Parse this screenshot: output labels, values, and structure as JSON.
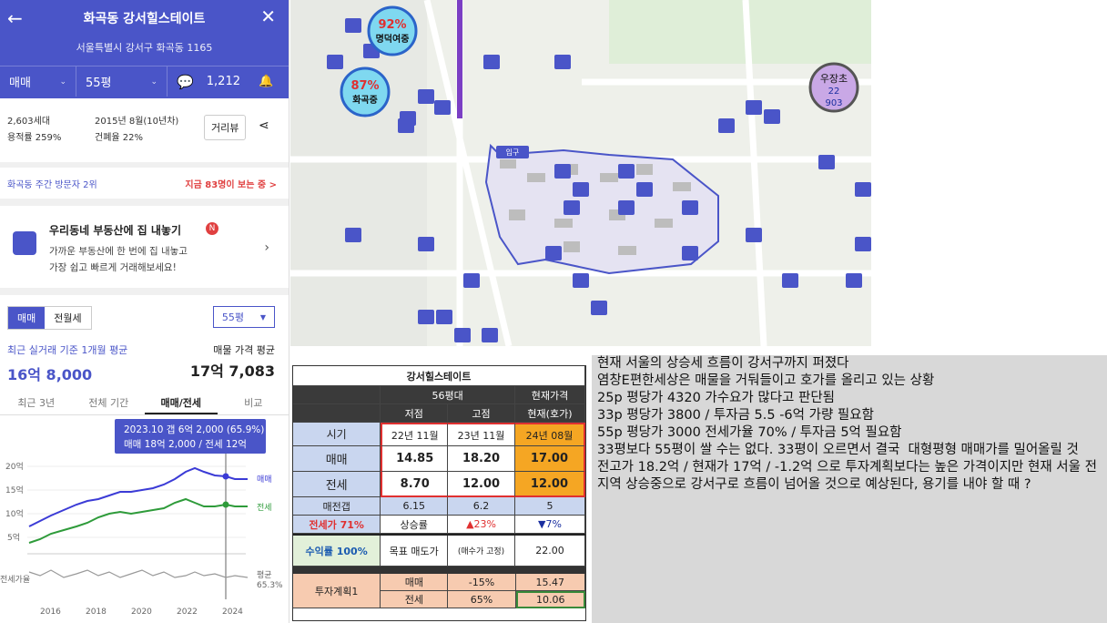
{
  "header": {
    "title": "화곡동 강서힐스테이트",
    "address": "서울특별시 강서구 화곡동 1165",
    "trade": "매매",
    "size": "55평",
    "comments": "1,212"
  },
  "complex": {
    "households": "2,603세대",
    "built": "2015년 8월(10년차)",
    "floor_area_ratio": "용적률 259%",
    "coverage": "건폐율 22%",
    "review_btn": "거리뷰"
  },
  "visitor": {
    "rank": "화곡동 주간 방문자 2위",
    "now": "지금 83명이 보는 중 >"
  },
  "promo": {
    "title": "우리동네 부동산에 집 내놓기",
    "badge": "N",
    "line1": "가까운 부동산에 한 번에 집 내놓고",
    "line2": "가장 쉽고 빠르게 거래해보세요!"
  },
  "price": {
    "tab1": "매매",
    "tab2": "전월세",
    "size": "55평",
    "recent_label": "최근 실거래 기준 1개월 평균",
    "recent_value": "16억 8,000",
    "ask_label": "매물 가격 평균",
    "ask_value": "17억 7,083"
  },
  "period_tabs": [
    "최근 3년",
    "전체 기간",
    "매매/전세",
    "비교"
  ],
  "chart": {
    "tooltip1": "2023.10  갭 6억 2,000 (65.9%)",
    "tooltip2": "매매 18억 2,000 / 전세 12억",
    "yticks": [
      "20억",
      "15억",
      "10억",
      "5억"
    ],
    "sale_label": "매매",
    "jeonse_label": "전세",
    "ratio_label": "전세가율",
    "avg_label": "평균",
    "avg_value": "65.3%",
    "xticks": [
      "2016",
      "2018",
      "2020",
      "2022",
      "2024"
    ]
  },
  "map_labels": {
    "school1": "92%",
    "school1_name": "명덕여중",
    "school2": "87%",
    "school2_name": "화곡중",
    "school3_name": "우장초",
    "school3_a": "22",
    "school3_b": "903",
    "entrance": "입구"
  },
  "table": {
    "title": "강서힐스테이트",
    "h_group": "56평대",
    "h_now": "현재가격",
    "h_low": "저점",
    "h_fix": "고점",
    "h_now2": "현재(호가)",
    "rows": [
      {
        "label": "시기",
        "a": "22년 11월",
        "b": "23년 11월",
        "c": "24년 08월"
      },
      {
        "label": "매매",
        "a": "14.85",
        "b": "18.20",
        "c": "17.00"
      },
      {
        "label": "전세",
        "a": "8.70",
        "b": "12.00",
        "c": "12.00"
      }
    ],
    "gap_label": "매전갭",
    "gap": [
      "6.15",
      "6.2",
      "5"
    ],
    "ratio_label": "전세가 71%",
    "rise_label": "상승률",
    "rise": "▲23%",
    "fall": "▼7%",
    "yield_label": "수익률 100%",
    "target_label": "목표 매도가",
    "target_note": "(매수가 고정)",
    "target": "22.00",
    "plan_label": "투자계획1",
    "plan_rows": [
      {
        "k": "매매",
        "p": "-15%",
        "v": "15.47"
      },
      {
        "k": "전세",
        "p": "65%",
        "v": "10.06"
      }
    ]
  },
  "note": [
    "현재 서울의 상승세 흐름이 강서구까지 퍼졌다",
    "염창E편한세상은 매물을 거둬들이고 호가를 올리고 있는 상황",
    "",
    "25p 평당가 4320 가수요가 많다고 판단됨",
    "33p 평당가 3800 / 투자금 5.5 -6억 가량 필요함",
    "55p 평당가 3000 전세가율 70% / 투자금 5억 필요함",
    "",
    "33평보다 55평이 쌀 수는 없다. 33평이 오르면서 결국  대형평형 매매가를 밀어올릴 것",
    "",
    "전고가 18.2억 / 현재가 17억 / -1.2억 으로 투자계획보다는 높은 가격이지만 현재 서울 전지역 상승중으로 강서구로 흐름이 넘어올 것으로 예상된다, 용기를 내야 할 때 ?"
  ],
  "colors": {
    "brand": "#4a55c8",
    "sale": "#3b3bd6",
    "jeonse": "#2e9b3a",
    "orange": "#f5a623",
    "red": "#e04040"
  }
}
